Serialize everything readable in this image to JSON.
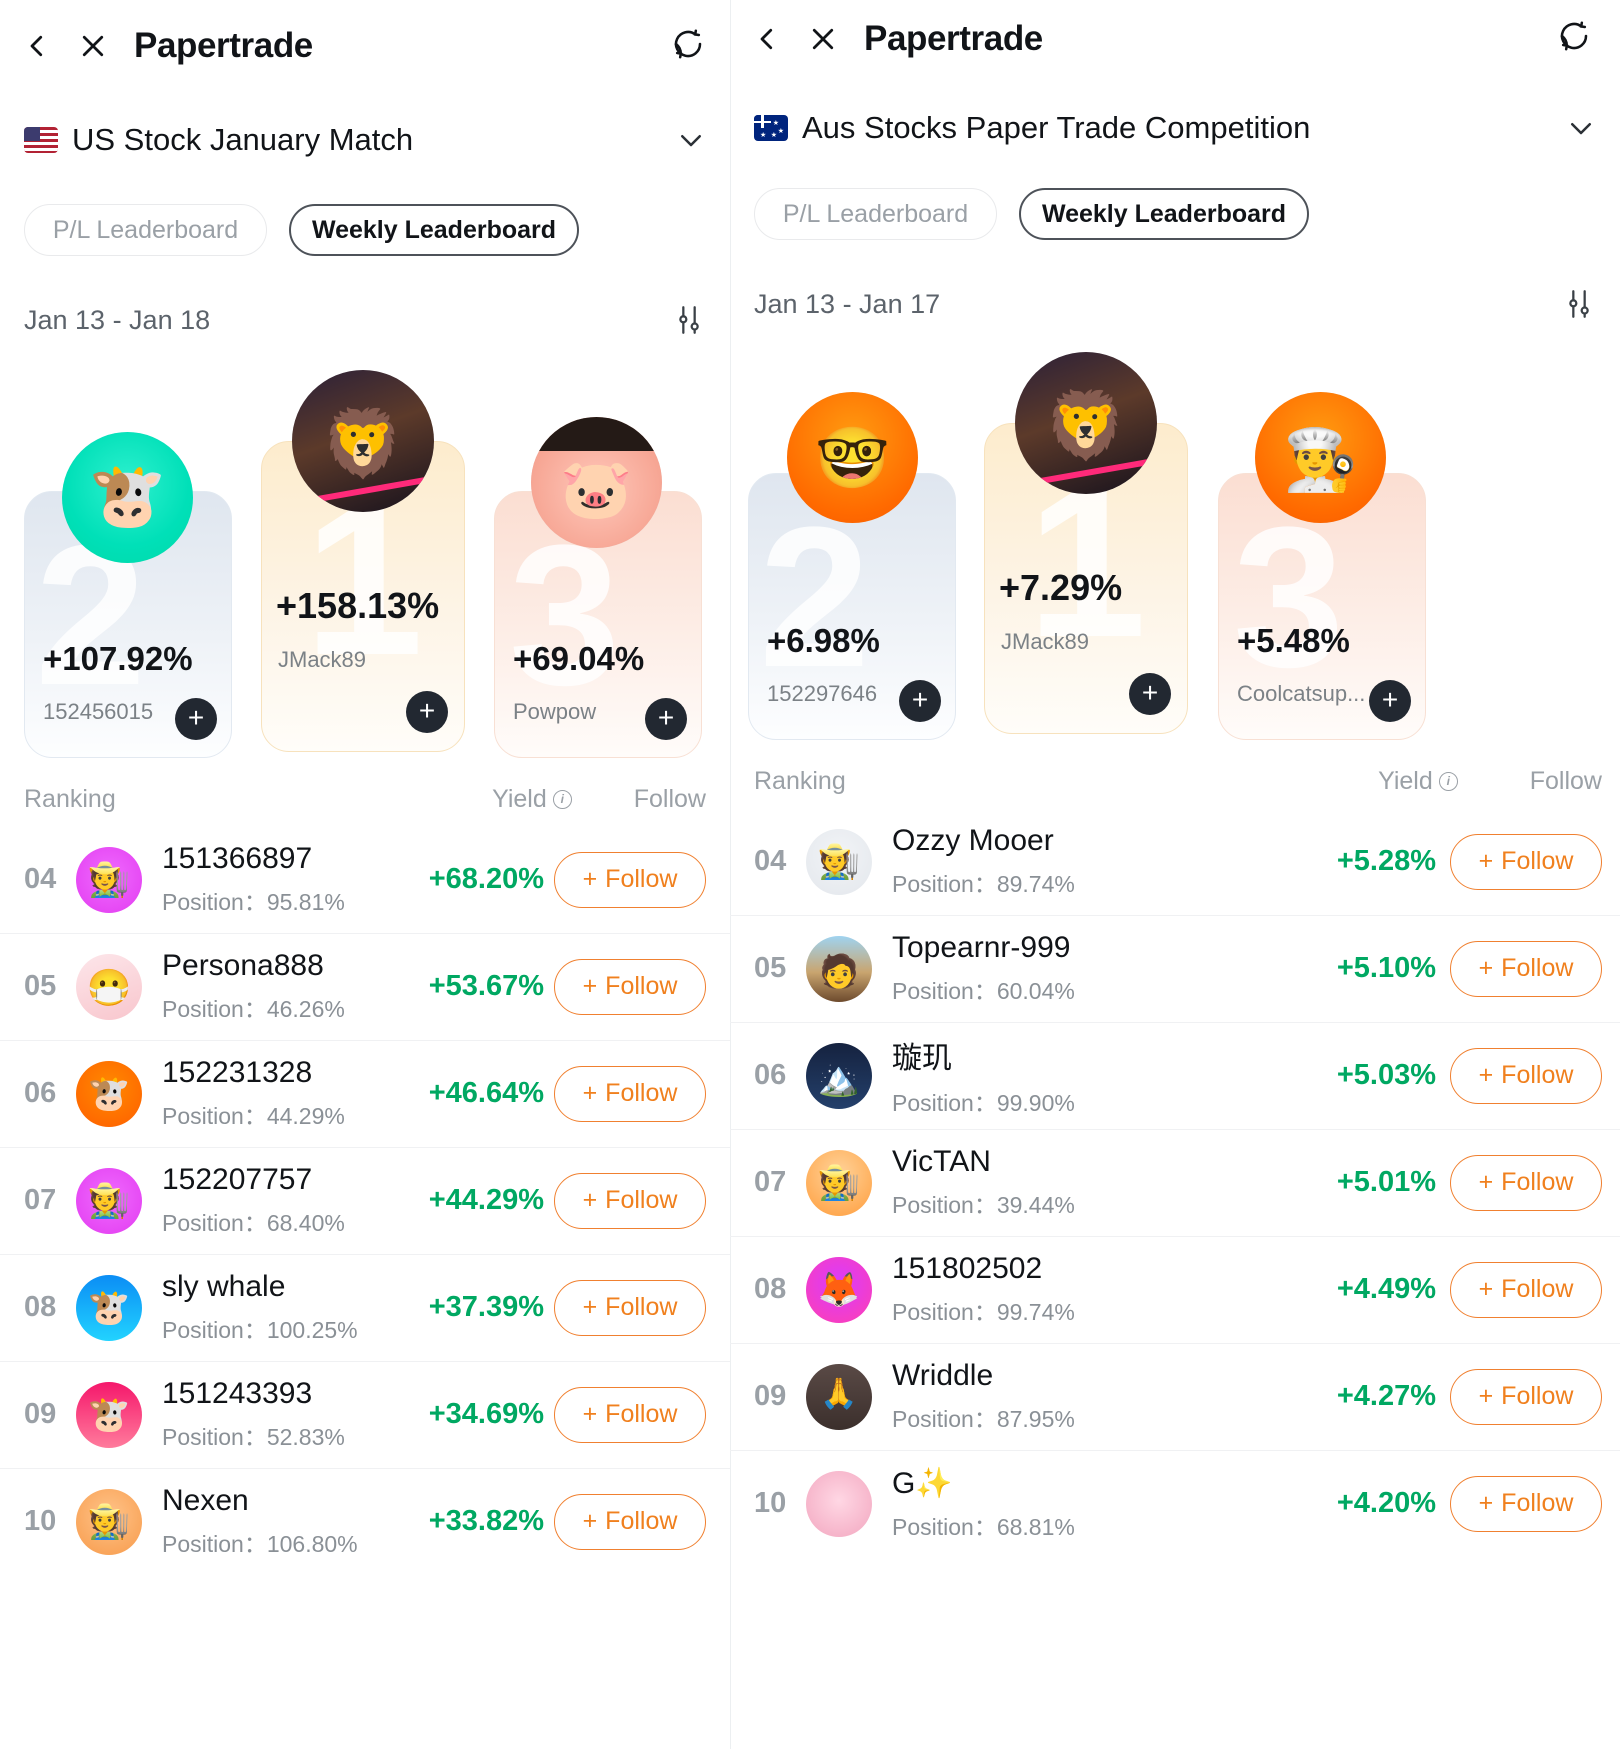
{
  "panels": [
    {
      "topbar": {
        "back_icon": "chevron-left-icon",
        "close_icon": "close-icon",
        "title": "Papertrade",
        "refresh_icon": "refresh-icon"
      },
      "contest": {
        "flag": "us-flag-icon",
        "name": "US Stock January Match",
        "chevron": "chevron-down-icon"
      },
      "tabs": [
        {
          "label": "P/L Leaderboard",
          "active": false
        },
        {
          "label": "Weekly Leaderboard",
          "active": true
        }
      ],
      "date_range": "Jan 13 - Jan 18",
      "filter_icon": "sliders-icon",
      "podium": [
        {
          "rank": "2",
          "pct": "+107.92%",
          "username": "152456015",
          "avatar": "avatar-cow-teal",
          "follow_icon": "plus-icon"
        },
        {
          "rank": "1",
          "pct": "+158.13%",
          "username": "JMack89",
          "avatar": "avatar-lion-photo",
          "follow_icon": "plus-icon"
        },
        {
          "rank": "3",
          "pct": "+69.04%",
          "username": "Powpow",
          "avatar": "avatar-pig-photo",
          "follow_icon": "plus-icon"
        }
      ],
      "list_headers": {
        "ranking": "Ranking",
        "yield": "Yield",
        "yield_info_icon": "info-icon",
        "follow": "Follow"
      },
      "rows": [
        {
          "rank": "04",
          "name": "151366897",
          "position_label": "Position：",
          "position": "95.81%",
          "yield": "+68.20%",
          "follow": "Follow",
          "avatar": "avatar-magenta-hat"
        },
        {
          "rank": "05",
          "name": "Persona888",
          "position_label": "Position：",
          "position": "46.26%",
          "yield": "+53.67%",
          "follow": "Follow",
          "avatar": "avatar-luffy-photo"
        },
        {
          "rank": "06",
          "name": "152231328",
          "position_label": "Position：",
          "position": "44.29%",
          "yield": "+46.64%",
          "follow": "Follow",
          "avatar": "avatar-orange-cow"
        },
        {
          "rank": "07",
          "name": "152207757",
          "position_label": "Position：",
          "position": "68.40%",
          "yield": "+44.29%",
          "follow": "Follow",
          "avatar": "avatar-magenta-hat"
        },
        {
          "rank": "08",
          "name": "sly whale",
          "position_label": "Position：",
          "position": "100.25%",
          "yield": "+37.39%",
          "follow": "Follow",
          "avatar": "avatar-blue-cow"
        },
        {
          "rank": "09",
          "name": "151243393",
          "position_label": "Position：",
          "position": "52.83%",
          "yield": "+34.69%",
          "follow": "Follow",
          "avatar": "avatar-pink-cow"
        },
        {
          "rank": "10",
          "name": "Nexen",
          "position_label": "Position：",
          "position": "106.80%",
          "yield": "+33.82%",
          "follow": "Follow",
          "avatar": "avatar-peach-cow"
        }
      ]
    },
    {
      "topbar": {
        "back_icon": "chevron-left-icon",
        "close_icon": "close-icon",
        "title": "Papertrade",
        "refresh_icon": "refresh-icon"
      },
      "contest": {
        "flag": "au-flag-icon",
        "name": "Aus Stocks Paper Trade Competition",
        "chevron": "chevron-down-icon"
      },
      "tabs": [
        {
          "label": "P/L Leaderboard",
          "active": false
        },
        {
          "label": "Weekly Leaderboard",
          "active": true
        }
      ],
      "date_range": "Jan 13 - Jan 17",
      "filter_icon": "sliders-icon",
      "podium": [
        {
          "rank": "2",
          "pct": "+6.98%",
          "username": "152297646",
          "avatar": "avatar-orange-glasses",
          "follow_icon": "plus-icon"
        },
        {
          "rank": "1",
          "pct": "+7.29%",
          "username": "JMack89",
          "avatar": "avatar-lion-photo",
          "follow_icon": "plus-icon"
        },
        {
          "rank": "3",
          "pct": "+5.48%",
          "username": "Coolcatsup...",
          "avatar": "avatar-chef-cow",
          "follow_icon": "plus-icon"
        }
      ],
      "list_headers": {
        "ranking": "Ranking",
        "yield": "Yield",
        "yield_info_icon": "info-icon",
        "follow": "Follow"
      },
      "rows": [
        {
          "rank": "04",
          "name": "Ozzy Mooer",
          "position_label": "Position：",
          "position": "89.74%",
          "yield": "+5.28%",
          "follow": "Follow",
          "avatar": "avatar-grey-cow"
        },
        {
          "rank": "05",
          "name": "Topearnr-999",
          "position_label": "Position：",
          "position": "60.04%",
          "yield": "+5.10%",
          "follow": "Follow",
          "avatar": "avatar-man-photo"
        },
        {
          "rank": "06",
          "name": "璇玑",
          "position_label": "Position：",
          "position": "99.90%",
          "yield": "+5.03%",
          "follow": "Follow",
          "avatar": "avatar-mountain-photo"
        },
        {
          "rank": "07",
          "name": "VicTAN",
          "position_label": "Position：",
          "position": "39.44%",
          "yield": "+5.01%",
          "follow": "Follow",
          "avatar": "avatar-orange-hat-cow"
        },
        {
          "rank": "08",
          "name": "151802502",
          "position_label": "Position：",
          "position": "99.74%",
          "yield": "+4.49%",
          "follow": "Follow",
          "avatar": "avatar-magenta-fox"
        },
        {
          "rank": "09",
          "name": "Wriddle",
          "position_label": "Position：",
          "position": "87.95%",
          "yield": "+4.27%",
          "follow": "Follow",
          "avatar": "avatar-wriddle-photo"
        },
        {
          "rank": "10",
          "name": "G✨",
          "position_label": "Position：",
          "position": "68.81%",
          "yield": "+4.20%",
          "follow": "Follow",
          "avatar": "avatar-pink-fluff-photo"
        }
      ]
    }
  ],
  "colors": {
    "yield_green": "#00a862",
    "follow_orange": "#f0801e",
    "text_primary": "#111418",
    "text_muted": "#9aa0a6"
  }
}
